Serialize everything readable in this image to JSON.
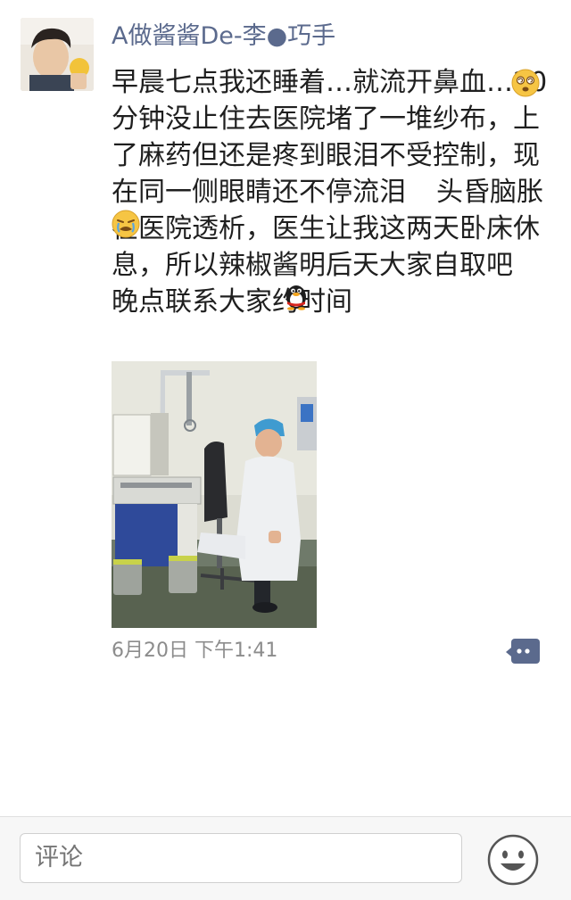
{
  "post": {
    "username": "A做酱酱De-李●巧手",
    "text_lines": [
      "早晨七点我还睡着…就流开鼻血",
      "…20分钟没止住去医院堵了一堆纱",
      "布，上了麻药但还是疼到眼泪不受",
      "控制，现在同一侧眼睛还不停流泪",
      "头昏脑胀在医院透析，医生让我",
      "这两天卧床休息，所以辣椒酱明后",
      "天大家自取吧",
      "晚点联系大家约时",
      "间"
    ],
    "timestamp": "6月20日  下午1:41",
    "emojis": {
      "dizzy": "dizzy-face-emoji",
      "crying": "crying-face-emoji",
      "penguin": "qq-penguin-emoji"
    }
  },
  "comment_bar": {
    "placeholder": "评论",
    "emoji_button": "smiley-icon"
  },
  "colors": {
    "username": "#5b6a8d",
    "timestamp": "#8c8c8c",
    "comment_icon": "#5b6a8d",
    "background": "#ffffff",
    "bar_background": "#f7f7f7"
  }
}
